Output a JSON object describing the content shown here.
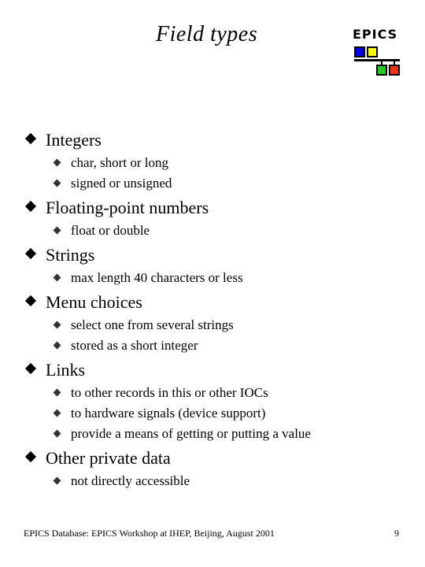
{
  "slide": {
    "title": "Field types",
    "logo": {
      "text": "EPICS",
      "colors": {
        "blue": "#0000ee",
        "yellow": "#ffff00",
        "green": "#22cc22",
        "red": "#ee3311"
      }
    },
    "bullets": [
      {
        "label": "Integers",
        "items": [
          "char, short or long",
          "signed or unsigned"
        ]
      },
      {
        "label": "Floating-point numbers",
        "items": [
          "float or double"
        ]
      },
      {
        "label": "Strings",
        "items": [
          "max length 40 characters or less"
        ]
      },
      {
        "label": "Menu choices",
        "items": [
          "select one from several strings",
          "stored as a short integer"
        ]
      },
      {
        "label": "Links",
        "items": [
          "to other records in this or other IOCs",
          "to hardware signals (device support)",
          "provide a means of getting or putting a value"
        ]
      },
      {
        "label": "Other private data",
        "items": [
          "not directly accessible"
        ]
      }
    ],
    "footer": "EPICS Database: EPICS Workshop at IHEP, Beijing, August 2001",
    "page_number": "9"
  }
}
